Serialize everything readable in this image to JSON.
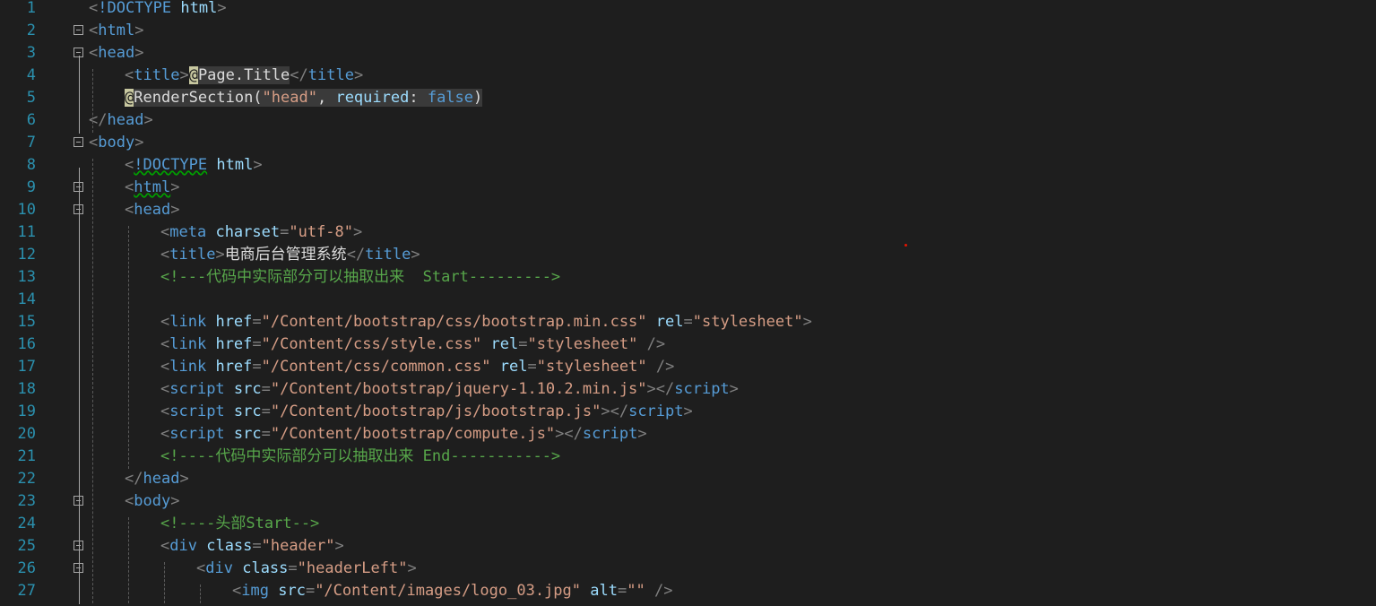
{
  "editor": {
    "lines": [
      {
        "n": "1",
        "fold": false,
        "indent": 0,
        "tokens": [
          [
            "punc",
            "<"
          ],
          [
            "tag",
            "!DOCTYPE"
          ],
          [
            "plain",
            " "
          ],
          [
            "attr",
            "html"
          ],
          [
            "punc",
            ">"
          ]
        ]
      },
      {
        "n": "2",
        "fold": true,
        "indent": 0,
        "tokens": [
          [
            "punc",
            "<"
          ],
          [
            "tag",
            "html"
          ],
          [
            "punc",
            ">"
          ]
        ]
      },
      {
        "n": "3",
        "fold": true,
        "indent": 0,
        "tokens": [
          [
            "punc",
            "<"
          ],
          [
            "tag",
            "head"
          ],
          [
            "punc",
            ">"
          ]
        ]
      },
      {
        "n": "4",
        "fold": false,
        "indent": 1,
        "tokens": [
          [
            "punc",
            "<"
          ],
          [
            "tag",
            "title"
          ],
          [
            "punc",
            ">"
          ],
          [
            "razor",
            "@"
          ],
          [
            "hlplain",
            "Page.Title"
          ],
          [
            "punc",
            "</"
          ],
          [
            "tag",
            "title"
          ],
          [
            "punc",
            ">"
          ]
        ]
      },
      {
        "n": "5",
        "fold": false,
        "indent": 1,
        "tokens": [
          [
            "razor",
            "@"
          ],
          [
            "hlplain",
            "RenderSection("
          ],
          [
            "hlstr",
            "\"head\""
          ],
          [
            "hlplain",
            ", "
          ],
          [
            "hlattr",
            "required"
          ],
          [
            "hlplain",
            ": "
          ],
          [
            "hlkw",
            "false"
          ],
          [
            "hlplain",
            ")"
          ]
        ]
      },
      {
        "n": "6",
        "fold": false,
        "indent": 0,
        "tokens": [
          [
            "punc",
            "</"
          ],
          [
            "tag",
            "head"
          ],
          [
            "punc",
            ">"
          ]
        ]
      },
      {
        "n": "7",
        "fold": true,
        "indent": 0,
        "tokens": [
          [
            "punc",
            "<"
          ],
          [
            "tag",
            "body"
          ],
          [
            "punc",
            ">"
          ]
        ]
      },
      {
        "n": "8",
        "fold": false,
        "indent": 1,
        "tokens": [
          [
            "punc",
            "<"
          ],
          [
            "sqtag",
            "!DOCTYPE"
          ],
          [
            "plain",
            " "
          ],
          [
            "attr",
            "html"
          ],
          [
            "punc",
            ">"
          ]
        ]
      },
      {
        "n": "9",
        "fold": true,
        "indent": 1,
        "tokens": [
          [
            "punc",
            "<"
          ],
          [
            "sqtag",
            "html"
          ],
          [
            "punc",
            ">"
          ]
        ]
      },
      {
        "n": "10",
        "fold": true,
        "indent": 1,
        "tokens": [
          [
            "punc",
            "<"
          ],
          [
            "tag",
            "head"
          ],
          [
            "punc",
            ">"
          ]
        ]
      },
      {
        "n": "11",
        "fold": false,
        "indent": 2,
        "tokens": [
          [
            "punc",
            "<"
          ],
          [
            "tag",
            "meta"
          ],
          [
            "plain",
            " "
          ],
          [
            "attr",
            "charset"
          ],
          [
            "punc",
            "="
          ],
          [
            "str",
            "\"utf-8\""
          ],
          [
            "punc",
            ">"
          ]
        ]
      },
      {
        "n": "12",
        "fold": false,
        "indent": 2,
        "tokens": [
          [
            "punc",
            "<"
          ],
          [
            "tag",
            "title"
          ],
          [
            "punc",
            ">"
          ],
          [
            "text",
            "电商后台管理系统"
          ],
          [
            "punc",
            "</"
          ],
          [
            "tag",
            "title"
          ],
          [
            "punc",
            ">"
          ]
        ]
      },
      {
        "n": "13",
        "fold": false,
        "indent": 2,
        "tokens": [
          [
            "comment",
            "<!---代码中实际部分可以抽取出来  Start--------->"
          ]
        ]
      },
      {
        "n": "14",
        "fold": false,
        "indent": 2,
        "tokens": []
      },
      {
        "n": "15",
        "fold": false,
        "indent": 2,
        "tokens": [
          [
            "punc",
            "<"
          ],
          [
            "tag",
            "link"
          ],
          [
            "plain",
            " "
          ],
          [
            "attr",
            "href"
          ],
          [
            "punc",
            "="
          ],
          [
            "str",
            "\"/Content/bootstrap/css/bootstrap.min.css\""
          ],
          [
            "plain",
            " "
          ],
          [
            "attr",
            "rel"
          ],
          [
            "punc",
            "="
          ],
          [
            "str",
            "\"stylesheet\""
          ],
          [
            "punc",
            ">"
          ]
        ]
      },
      {
        "n": "16",
        "fold": false,
        "indent": 2,
        "tokens": [
          [
            "punc",
            "<"
          ],
          [
            "tag",
            "link"
          ],
          [
            "plain",
            " "
          ],
          [
            "attr",
            "href"
          ],
          [
            "punc",
            "="
          ],
          [
            "str",
            "\"/Content/css/style.css\""
          ],
          [
            "plain",
            " "
          ],
          [
            "attr",
            "rel"
          ],
          [
            "punc",
            "="
          ],
          [
            "str",
            "\"stylesheet\""
          ],
          [
            "plain",
            " "
          ],
          [
            "punc",
            "/>"
          ]
        ]
      },
      {
        "n": "17",
        "fold": false,
        "indent": 2,
        "tokens": [
          [
            "punc",
            "<"
          ],
          [
            "tag",
            "link"
          ],
          [
            "plain",
            " "
          ],
          [
            "attr",
            "href"
          ],
          [
            "punc",
            "="
          ],
          [
            "str",
            "\"/Content/css/common.css\""
          ],
          [
            "plain",
            " "
          ],
          [
            "attr",
            "rel"
          ],
          [
            "punc",
            "="
          ],
          [
            "str",
            "\"stylesheet\""
          ],
          [
            "plain",
            " "
          ],
          [
            "punc",
            "/>"
          ]
        ]
      },
      {
        "n": "18",
        "fold": false,
        "indent": 2,
        "tokens": [
          [
            "punc",
            "<"
          ],
          [
            "tag",
            "script"
          ],
          [
            "plain",
            " "
          ],
          [
            "attr",
            "src"
          ],
          [
            "punc",
            "="
          ],
          [
            "str",
            "\"/Content/bootstrap/jquery-1.10.2.min.js\""
          ],
          [
            "punc",
            "></"
          ],
          [
            "tag",
            "script"
          ],
          [
            "punc",
            ">"
          ]
        ]
      },
      {
        "n": "19",
        "fold": false,
        "indent": 2,
        "tokens": [
          [
            "punc",
            "<"
          ],
          [
            "tag",
            "script"
          ],
          [
            "plain",
            " "
          ],
          [
            "attr",
            "src"
          ],
          [
            "punc",
            "="
          ],
          [
            "str",
            "\"/Content/bootstrap/js/bootstrap.js\""
          ],
          [
            "punc",
            "></"
          ],
          [
            "tag",
            "script"
          ],
          [
            "punc",
            ">"
          ]
        ]
      },
      {
        "n": "20",
        "fold": false,
        "indent": 2,
        "tokens": [
          [
            "punc",
            "<"
          ],
          [
            "tag",
            "script"
          ],
          [
            "plain",
            " "
          ],
          [
            "attr",
            "src"
          ],
          [
            "punc",
            "="
          ],
          [
            "str",
            "\"/Content/bootstrap/compute.js\""
          ],
          [
            "punc",
            "></"
          ],
          [
            "tag",
            "script"
          ],
          [
            "punc",
            ">"
          ]
        ]
      },
      {
        "n": "21",
        "fold": false,
        "indent": 2,
        "tokens": [
          [
            "comment",
            "<!----代码中实际部分可以抽取出来 End----------->"
          ]
        ]
      },
      {
        "n": "22",
        "fold": false,
        "indent": 1,
        "tokens": [
          [
            "punc",
            "</"
          ],
          [
            "tag",
            "head"
          ],
          [
            "punc",
            ">"
          ]
        ]
      },
      {
        "n": "23",
        "fold": true,
        "indent": 1,
        "tokens": [
          [
            "punc",
            "<"
          ],
          [
            "tag",
            "body"
          ],
          [
            "punc",
            ">"
          ]
        ]
      },
      {
        "n": "24",
        "fold": false,
        "indent": 2,
        "tokens": [
          [
            "comment",
            "<!----头部Start-->"
          ]
        ]
      },
      {
        "n": "25",
        "fold": true,
        "indent": 2,
        "tokens": [
          [
            "punc",
            "<"
          ],
          [
            "tag",
            "div"
          ],
          [
            "plain",
            " "
          ],
          [
            "attr",
            "class"
          ],
          [
            "punc",
            "="
          ],
          [
            "str",
            "\"header\""
          ],
          [
            "punc",
            ">"
          ]
        ]
      },
      {
        "n": "26",
        "fold": true,
        "indent": 3,
        "tokens": [
          [
            "punc",
            "<"
          ],
          [
            "tag",
            "div"
          ],
          [
            "plain",
            " "
          ],
          [
            "attr",
            "class"
          ],
          [
            "punc",
            "="
          ],
          [
            "str",
            "\"headerLeft\""
          ],
          [
            "punc",
            ">"
          ]
        ]
      },
      {
        "n": "27",
        "fold": false,
        "indent": 4,
        "tokens": [
          [
            "punc",
            "<"
          ],
          [
            "tag",
            "img"
          ],
          [
            "plain",
            " "
          ],
          [
            "attr",
            "src"
          ],
          [
            "punc",
            "="
          ],
          [
            "str",
            "\"/Content/images/logo_03.jpg\""
          ],
          [
            "plain",
            " "
          ],
          [
            "attr",
            "alt"
          ],
          [
            "punc",
            "="
          ],
          [
            "str",
            "\"\""
          ],
          [
            "plain",
            " "
          ],
          [
            "punc",
            "/>"
          ]
        ]
      }
    ]
  },
  "colors": {
    "background": "#1e1e1e",
    "line_number": "#2b91af",
    "tag": "#569cd6",
    "attribute": "#9cdcfe",
    "string": "#d69d85",
    "comment": "#57a64a",
    "punctuation": "#808080"
  }
}
